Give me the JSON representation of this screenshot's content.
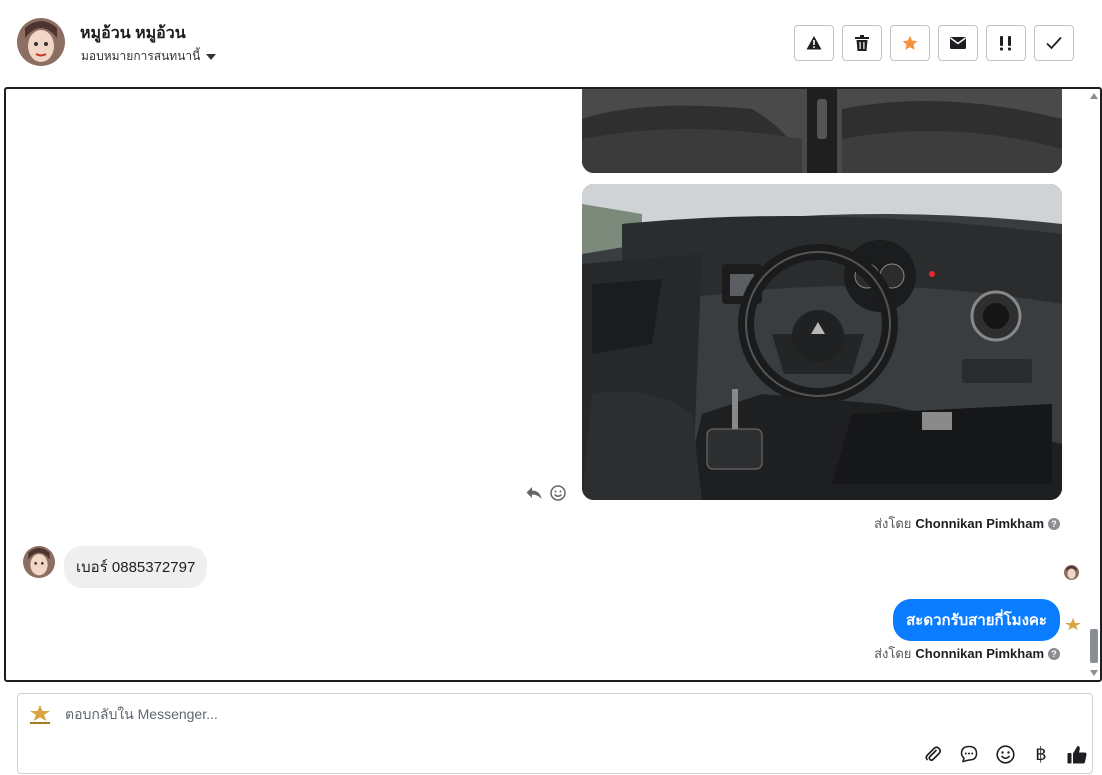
{
  "header": {
    "contact_name": "หมูอ้วน หมูอ้วน",
    "assign_label": "มอบหมายการสนทนานี้",
    "tools": [
      {
        "name": "spam-button",
        "icon": "warning-icon"
      },
      {
        "name": "delete-button",
        "icon": "trash-icon"
      },
      {
        "name": "star-button",
        "icon": "star-icon",
        "color": "#f7923b"
      },
      {
        "name": "mark-unread-button",
        "icon": "envelope-icon"
      },
      {
        "name": "follow-up-button",
        "icon": "exclamation-icon"
      },
      {
        "name": "done-button",
        "icon": "check-icon"
      }
    ]
  },
  "conversation": {
    "sent_by_prefix": "ส่งโดย",
    "sent_by_name": "Chonnikan Pimkham",
    "incoming_message": "เบอร์ 0885372797",
    "outgoing_message": "สะดวกรับสายกี่โมงคะ",
    "outgoing_color": "#0a7cff"
  },
  "composer": {
    "placeholder": "ตอบกลับใน Messenger...",
    "baht_symbol": "฿"
  }
}
